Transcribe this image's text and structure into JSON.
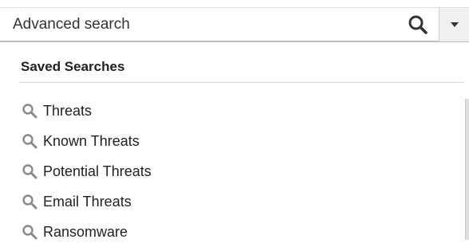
{
  "search": {
    "placeholder": "Advanced search",
    "value": ""
  },
  "icons": {
    "search_button": "search-icon",
    "dropdown_button": "caret-down-icon",
    "saved_item": "search-icon"
  },
  "saved_searches": {
    "heading": "Saved Searches",
    "items": [
      {
        "label": "Threats"
      },
      {
        "label": "Known Threats"
      },
      {
        "label": "Potential Threats"
      },
      {
        "label": "Email Threats"
      },
      {
        "label": "Ransomware"
      }
    ]
  },
  "colors": {
    "text": "#222222",
    "item_icon": "#8a8a8a",
    "search_icon": "#333333",
    "divider": "#d6d6d6"
  }
}
